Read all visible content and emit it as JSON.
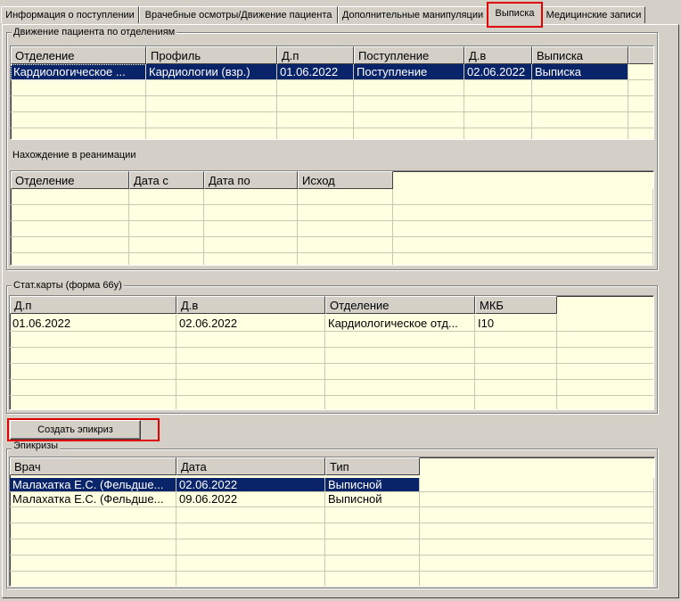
{
  "tabs": [
    {
      "label": "Информация о поступлении"
    },
    {
      "label": "Врачебные осмотры/Движение пациента"
    },
    {
      "label": "Дополнительные манипуляции"
    },
    {
      "label": "Выписка"
    },
    {
      "label": "Медицинские записи"
    }
  ],
  "movement": {
    "title": "Движение пациента по отделениям",
    "columns": [
      "Отделение",
      "Профиль",
      "Д.п",
      "Поступление",
      "Д.в",
      "Выписка"
    ],
    "rows": [
      [
        "Кардиологическое ...",
        "Кардиологии (взр.)",
        "01.06.2022",
        "Поступление",
        "02.06.2022",
        "Выписка"
      ]
    ]
  },
  "reanimation": {
    "title": "Нахождение в реанимации",
    "columns": [
      "Отделение",
      "Дата с",
      "Дата по",
      "Исход"
    ],
    "rows": []
  },
  "statcards": {
    "title": "Стат.карты (форма 66у)",
    "columns": [
      "Д.п",
      "Д.в",
      "Отделение",
      "МКБ"
    ],
    "rows": [
      [
        "01.06.2022",
        "02.06.2022",
        "Кардиологическое отд...",
        "I10"
      ]
    ]
  },
  "create_button": {
    "label": "Создать эпикриз"
  },
  "epicrises": {
    "title": "Эпикризы",
    "columns": [
      "Врач",
      "Дата",
      "Тип"
    ],
    "rows": [
      [
        "Малахатка Е.С. (Фельдше...",
        "02.06.2022",
        "Выписной"
      ],
      [
        "Малахатка Е.С. (Фельдше...",
        "09.06.2022",
        "Выписной"
      ]
    ]
  },
  "colors": {
    "selection": "#0a246a",
    "grid_background": "#ffffe1",
    "highlight": "#e00000"
  }
}
